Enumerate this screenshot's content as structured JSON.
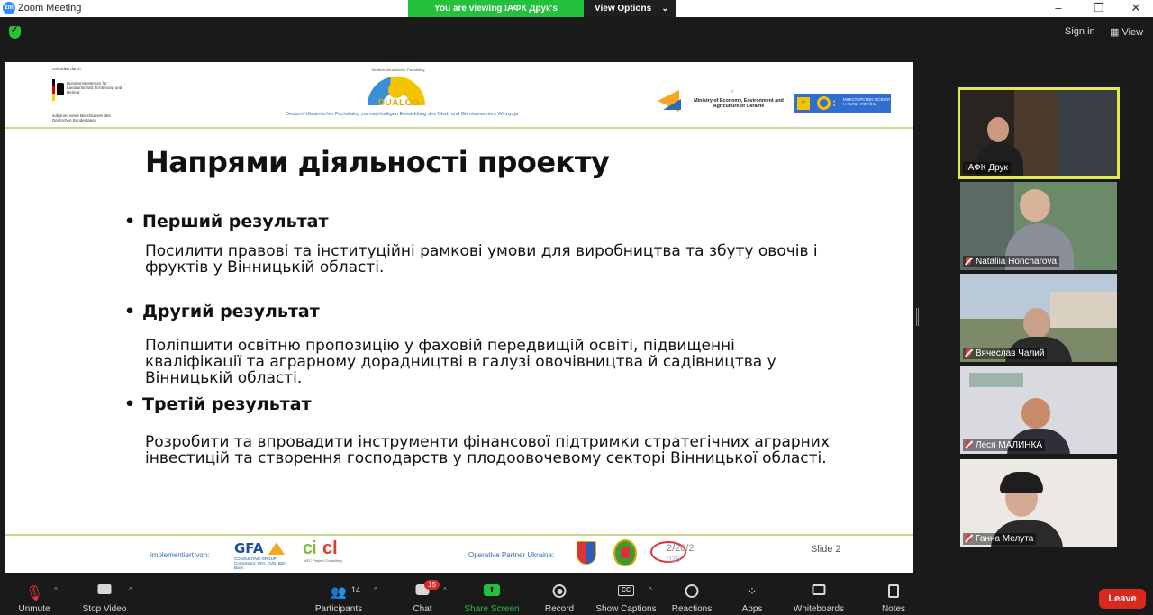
{
  "window": {
    "title": "Zoom Meeting",
    "app_icon_text": "zm",
    "controls": [
      "–",
      "❐",
      "✕"
    ]
  },
  "viewing": {
    "banner": "You are viewing ІАФК Друк's screen",
    "options_label": "View Options"
  },
  "topbar": {
    "signin": "Sign in",
    "view": "View"
  },
  "slide": {
    "gov_logo": {
      "line1": "Gefördert durch:",
      "line2": "Bundesministerium für Landwirtschaft, Ernährung und Heimat",
      "line3": "aufgrund eines Beschlusses des Deutschen Bundestages"
    },
    "dialog_arc": "Deutsch-Ukrainischer Fachdialog",
    "dialog_name": "DUALOG",
    "dialog_sub": "Deutsch-Ukrainischer Fachdialog zur nachhaltigen Entwicklung des Obst- und Gemüsesektors Winnyzja",
    "mineco": "Ministry of Economy, Environment and Agriculture of Ukraine",
    "mineco_tryzub": "♆",
    "mon_text": "МІНІСТЕРСТВО ОСВІТИ І НАУКИ УКРАЇНИ",
    "mon_tryzub": "♆",
    "title": "Напрями діяльності проекту",
    "bullets": [
      {
        "heading": "Перший результат",
        "text": "Посилити правові та інституційні рамкові умови для виробництва та збуту овочів і фруктів у Вінницькій області."
      },
      {
        "heading": "Другий результат",
        "text": "Поліпшити освітню пропозицію у фаховій передвищій освіті, підвищенні кваліфікації та аграрному дорадництві в галузі овочівництва й садівництва у Вінницькій області."
      },
      {
        "heading": "Третій результат",
        "text": "Розробити та впровадити інструменти фінансової підтримки стратегічних аграрних інвестицій та створення господарств у плодоовочевому секторі Вінницької області."
      }
    ],
    "bullet_symbol": "•",
    "implemented_by": "implementiert von:",
    "gfa": {
      "name": "GFA",
      "sub": "CONSULTING GROUP Consortium: GFA, EVD, BZH, Bonn"
    },
    "cicl": {
      "name_a": "ci",
      "name_b": "cl",
      "sub": "AFC Project Consulting"
    },
    "partner_label": "Operative Partner Ukraine:",
    "date_fragment": "2/20/2",
    "date_fragment2": "026",
    "slide_number": "Slide 2"
  },
  "participants": [
    {
      "name": "ІАФК Друк",
      "muted": false,
      "active": true
    },
    {
      "name": "Nataliia Honcharova",
      "muted": true,
      "active": false
    },
    {
      "name": "Вячеслав Чалий",
      "muted": true,
      "active": false
    },
    {
      "name": "Леся МАЛИНКА",
      "muted": true,
      "active": false
    },
    {
      "name": "Ганна Мелута",
      "muted": true,
      "active": false
    }
  ],
  "toolbar": {
    "unmute": "Unmute",
    "stop_video": "Stop Video",
    "participants": "Participants",
    "participants_count": "14",
    "chat": "Chat",
    "chat_badge": "15",
    "share_screen": "Share Screen",
    "record": "Record",
    "show_captions": "Show Captions",
    "captions_icon": "CC",
    "reactions": "Reactions",
    "apps": "Apps",
    "whiteboards": "Whiteboards",
    "notes": "Notes",
    "leave": "Leave"
  },
  "colors": {
    "accent_green": "#23c13c",
    "active_border": "#e0ec4e",
    "leave_red": "#d9281e",
    "rule_green": "#c9d88a"
  }
}
